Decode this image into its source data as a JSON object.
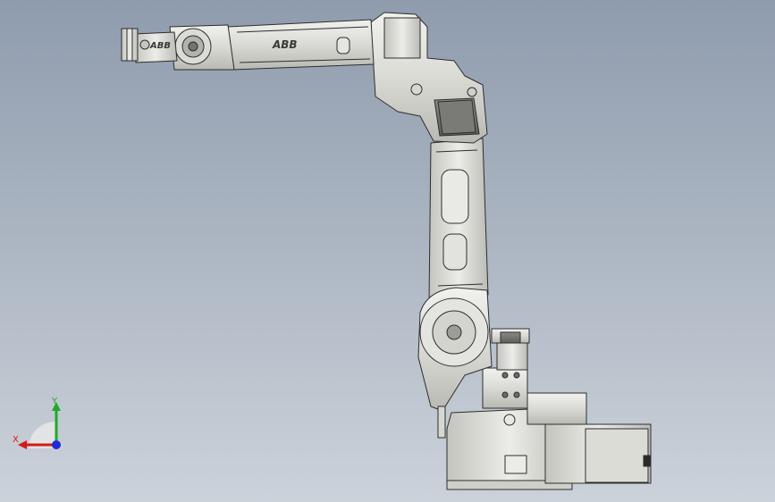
{
  "model": {
    "brand_label_forearm": "ABB",
    "brand_label_wrist": "ABB"
  },
  "triad": {
    "x_label": "X",
    "y_label": "Y",
    "colors": {
      "x": "#d41a1a",
      "y": "#1faa2a",
      "z": "#1c2bd8"
    }
  },
  "colors": {
    "metal_light": "#e6e6e3",
    "metal_mid": "#d3d3ce",
    "metal_dark": "#a9a9a3",
    "outline": "#2d2d2d"
  }
}
